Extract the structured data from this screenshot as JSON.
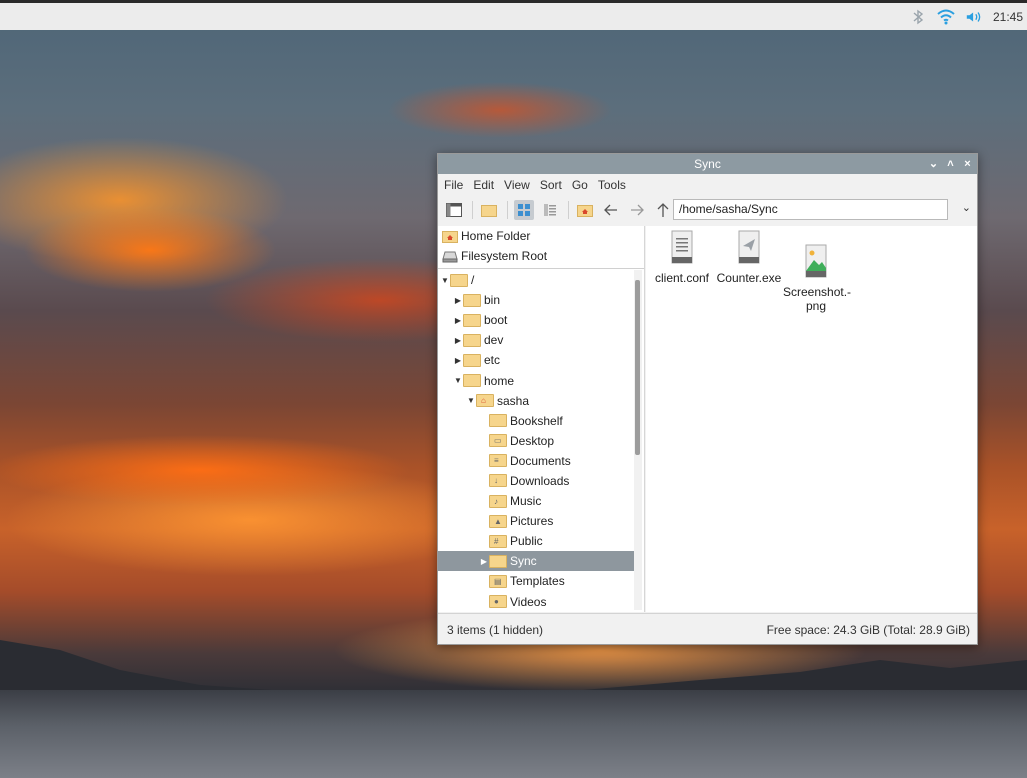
{
  "panel": {
    "clock": "21:45",
    "tray_icons": [
      "bluetooth-icon",
      "wifi-icon",
      "volume-icon"
    ]
  },
  "window": {
    "title": "Sync",
    "controls": [
      "minimize",
      "maximize",
      "close"
    ],
    "menu": [
      "File",
      "Edit",
      "View",
      "Sort",
      "Go",
      "Tools"
    ],
    "path": "/home/sasha/Sync",
    "places": [
      "Home Folder",
      "Filesystem Root"
    ],
    "tree": [
      {
        "label": "/",
        "depth": 0,
        "expanded": true,
        "icon": "folder"
      },
      {
        "label": "bin",
        "depth": 1,
        "expanded": false,
        "icon": "folder"
      },
      {
        "label": "boot",
        "depth": 1,
        "expanded": false,
        "icon": "folder"
      },
      {
        "label": "dev",
        "depth": 1,
        "expanded": false,
        "icon": "folder"
      },
      {
        "label": "etc",
        "depth": 1,
        "expanded": false,
        "icon": "folder"
      },
      {
        "label": "home",
        "depth": 1,
        "expanded": true,
        "icon": "folder"
      },
      {
        "label": "sasha",
        "depth": 2,
        "expanded": true,
        "icon": "home-folder"
      },
      {
        "label": "Bookshelf",
        "depth": 3,
        "icon": "folder"
      },
      {
        "label": "Desktop",
        "depth": 3,
        "icon": "desktop-folder"
      },
      {
        "label": "Documents",
        "depth": 3,
        "icon": "documents-folder"
      },
      {
        "label": "Downloads",
        "depth": 3,
        "icon": "downloads-folder"
      },
      {
        "label": "Music",
        "depth": 3,
        "icon": "music-folder"
      },
      {
        "label": "Pictures",
        "depth": 3,
        "icon": "pictures-folder"
      },
      {
        "label": "Public",
        "depth": 3,
        "icon": "public-folder"
      },
      {
        "label": "Sync",
        "depth": 3,
        "expanded": false,
        "selected": true,
        "icon": "folder"
      },
      {
        "label": "Templates",
        "depth": 3,
        "icon": "templates-folder"
      },
      {
        "label": "Videos",
        "depth": 3,
        "icon": "videos-folder"
      }
    ],
    "files": [
      {
        "name": "client.conf",
        "icon": "text-file-icon"
      },
      {
        "name": "Counter.exe",
        "icon": "executable-file-icon"
      },
      {
        "name": "Screenshot.-\npng",
        "icon": "image-file-icon"
      }
    ],
    "status_left": "3 items (1 hidden)",
    "status_right": "Free space: 24.3 GiB (Total: 28.9 GiB)"
  },
  "colors": {
    "titlebar": "#8d9aa2",
    "selection": "#8e979e",
    "folder": "#f6d58c"
  }
}
